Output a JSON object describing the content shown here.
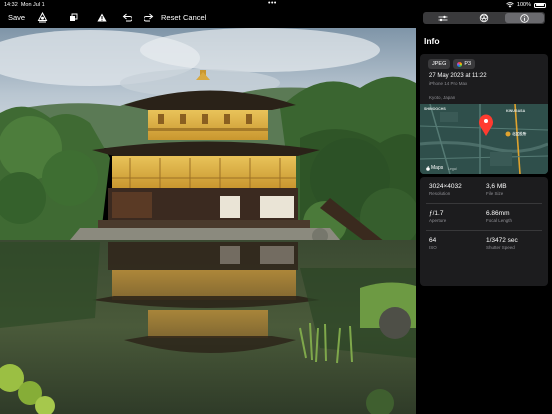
{
  "status": {
    "time": "14:32",
    "date": "Mon Jul 1",
    "battery": "100%"
  },
  "toolbar": {
    "save": "Save",
    "reset": "Reset",
    "cancel": "Cancel",
    "icons": [
      "markup-icon",
      "crop-icon",
      "warning-icon",
      "undo-icon",
      "redo-icon"
    ]
  },
  "tabs": {
    "items": [
      "adjust-icon",
      "filters-icon",
      "info-icon"
    ],
    "active": "info-icon"
  },
  "info": {
    "title": "Info",
    "format_badge": "JPEG",
    "color_badge": "P3",
    "date": "27 May 2023 at 11:22",
    "device": "iPhone 14 Pro Max",
    "location": "Kyoto, Japan",
    "map": {
      "labels": [
        "SHINOOCHS",
        "KINUGASA",
        "北区役所"
      ],
      "brand": "Maps",
      "legal": "Legal"
    },
    "metadata": [
      {
        "value": "3024×4032",
        "label": "Resolution"
      },
      {
        "value": "3,6 MB",
        "label": "File Size"
      },
      {
        "value": "ƒ/1.7",
        "label": "Aperture"
      },
      {
        "value": "6.86mm",
        "label": "Focal Length"
      },
      {
        "value": "64",
        "label": "ISO"
      },
      {
        "value": "1/3472 sec",
        "label": "Shutter Speed"
      }
    ]
  },
  "colors": {
    "accent_red": "#ff3b30",
    "card_bg": "#1c1c1e",
    "segment_bg": "#3a3a3c"
  }
}
